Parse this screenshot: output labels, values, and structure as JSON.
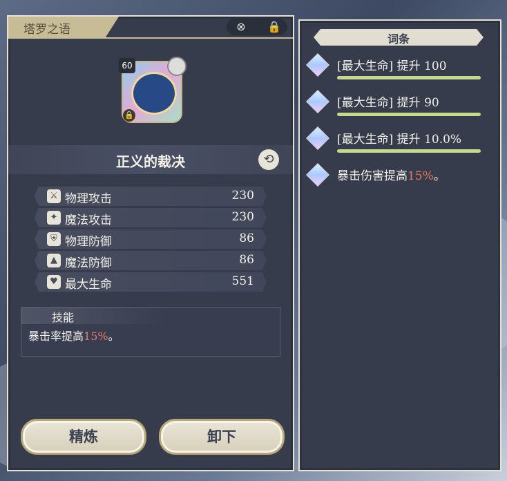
{
  "header": {
    "title": "塔罗之语"
  },
  "card": {
    "level": "60",
    "name": "正义的裁决"
  },
  "stats": [
    {
      "icon": "sword-icon",
      "glyph": "⚔",
      "label": "物理攻击",
      "value": "230"
    },
    {
      "icon": "wand-icon",
      "glyph": "✦",
      "label": "魔法攻击",
      "value": "230"
    },
    {
      "icon": "shield-icon",
      "glyph": "⛨",
      "label": "物理防御",
      "value": "86"
    },
    {
      "icon": "hat-icon",
      "glyph": "▲",
      "label": "魔法防御",
      "value": "86"
    },
    {
      "icon": "heart-icon",
      "glyph": "♥",
      "label": "最大生命",
      "value": "551"
    }
  ],
  "skill": {
    "title": "技能",
    "desc_prefix": "暴击率提高",
    "desc_highlight": "15%",
    "desc_suffix": "。"
  },
  "buttons": {
    "refine": "精炼",
    "unequip": "卸下"
  },
  "affixes": {
    "title": "词条",
    "items": [
      {
        "text": "[最大生命] 提升 100"
      },
      {
        "text": "[最大生命] 提升 90"
      },
      {
        "text": "[最大生命] 提升 10.0%"
      }
    ],
    "special": {
      "prefix": "暴击伤害提高",
      "highlight": "15%",
      "suffix": "。"
    }
  },
  "colors": {
    "highlight": "#e9795b",
    "panel": "#363c4c",
    "accent": "#c8bc97",
    "bar": "#c7d98a"
  }
}
